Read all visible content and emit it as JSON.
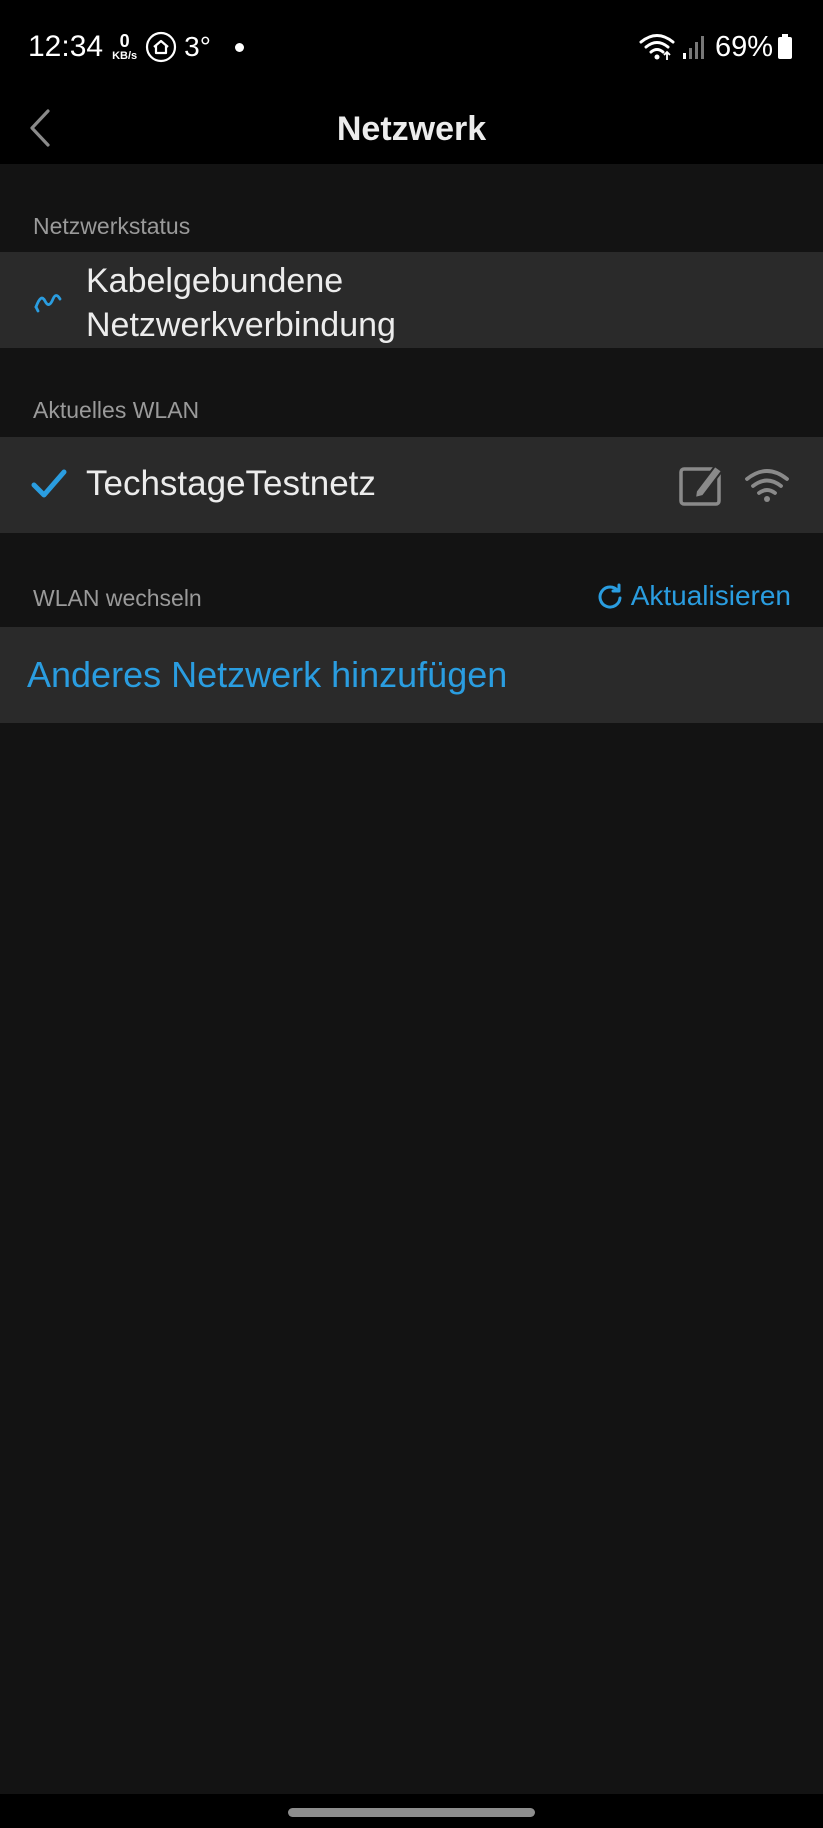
{
  "status_bar": {
    "time": "12:34",
    "speed_value": "0",
    "speed_unit": "KB/s",
    "temperature": "3°",
    "battery": "69%"
  },
  "header": {
    "title": "Netzwerk",
    "back_icon": "chevron-left-icon"
  },
  "network_status": {
    "section_label": "Netzwerkstatus",
    "connection_icon": "wired-network-icon",
    "connection_label": "Kabelgebundene Netzwerkverbindung"
  },
  "current_wlan": {
    "section_label": "Aktuelles WLAN",
    "check_icon": "check-icon",
    "ssid": "TechstageTestnetz",
    "edit_icon": "edit-icon",
    "signal_icon": "wifi-signal-icon"
  },
  "switch_wlan": {
    "section_label": "WLAN wechseln",
    "refresh_icon": "refresh-icon",
    "refresh_label": "Aktualisieren",
    "add_network_label": "Anderes Netzwerk hinzufügen"
  },
  "colors": {
    "accent": "#2a9de0",
    "background": "#131313",
    "row_background": "#2a2a2a",
    "bar_background": "#000000"
  }
}
